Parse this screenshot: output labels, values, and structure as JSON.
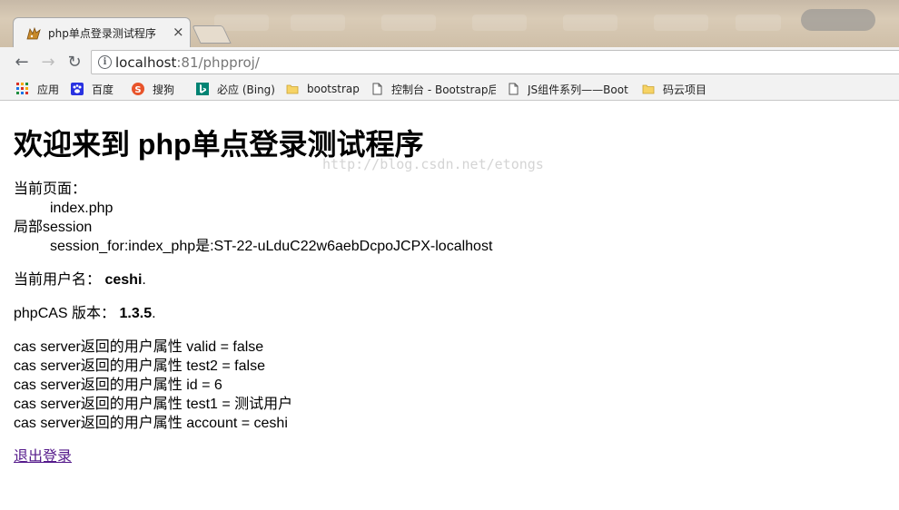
{
  "browser": {
    "tab": {
      "title": "php单点登录测试程序",
      "close": "×"
    },
    "nav": {
      "back": "←",
      "forward": "→",
      "reload": "↻"
    },
    "address": {
      "host": "localhost",
      "rest": ":81/phpproj/"
    },
    "bookmarks": [
      {
        "label": "应用",
        "icon": "apps-grid-icon"
      },
      {
        "label": "百度",
        "icon": "baidu-paw-icon"
      },
      {
        "label": "搜狗",
        "icon": "sogou-icon"
      },
      {
        "label": "必应 (Bing)",
        "icon": "bing-icon"
      },
      {
        "label": "bootstrap",
        "icon": "folder-icon"
      },
      {
        "label": "控制台 - Bootstrap后",
        "icon": "page-icon"
      },
      {
        "label": "JS组件系列——Boot",
        "icon": "page-icon"
      },
      {
        "label": "码云项目",
        "icon": "folder-icon"
      }
    ]
  },
  "page": {
    "heading": "欢迎来到 php单点登录测试程序",
    "current_page_label": "当前页面：",
    "current_page_value": "index.php",
    "session_label": "局部session",
    "session_value": "session_for:index_php是:ST-22-uLduC22w6aebDcpoJCPX-localhost",
    "username_label": "当前用户名：",
    "username_value": "ceshi",
    "username_suffix": ".",
    "phpcas_label": "phpCAS 版本：",
    "phpcas_value": "1.3.5",
    "phpcas_suffix": ".",
    "attributes": [
      "cas server返回的用户属性 valid = false",
      "cas server返回的用户属性 test2 = false",
      "cas server返回的用户属性 id = 6",
      "cas server返回的用户属性 test1 = 测试用户",
      "cas server返回的用户属性 account = ceshi"
    ],
    "logout_link": "退出登录"
  },
  "watermark": "http://blog.csdn.net/etongs",
  "colors": {
    "link_visited": "#551a8b",
    "chrome_bg": "#f2f2f2"
  }
}
